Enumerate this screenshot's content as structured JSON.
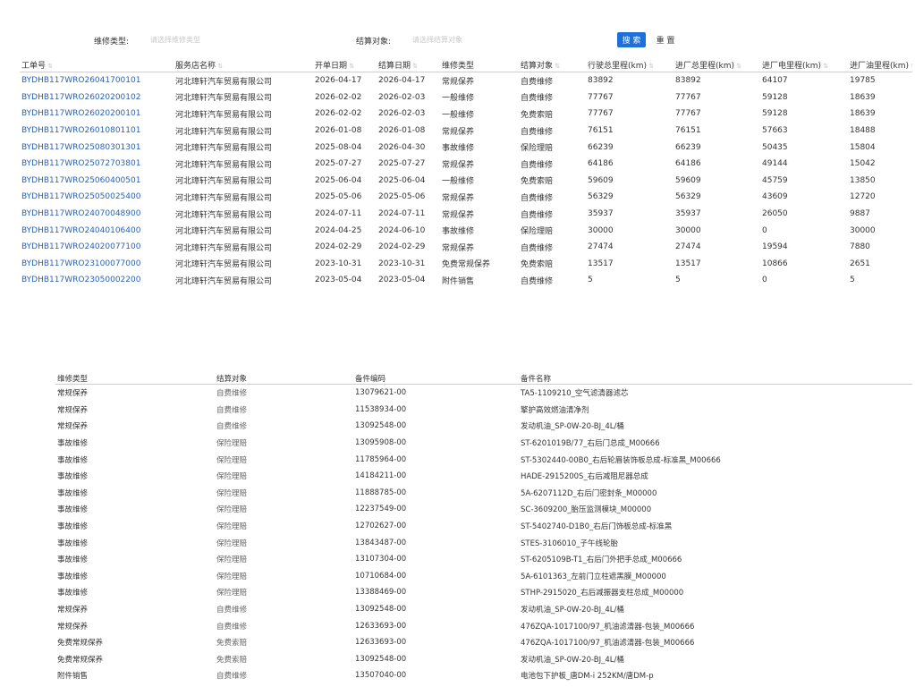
{
  "filters": {
    "repair_type_label": "维修类型:",
    "repair_type_placeholder": "请选择维修类型",
    "settlement_label": "结算对象:",
    "settlement_placeholder": "请选择结算对象",
    "search_button": "搜 索",
    "reset_button": "重 置",
    "accent_color": "#1e6fd9",
    "link_color": "#2b63b6"
  },
  "orders": {
    "columns": [
      "工单号",
      "服务店名称",
      "开单日期",
      "结算日期",
      "维修类型",
      "结算对象",
      "行驶总里程(km)",
      "进厂总里程(km)",
      "进厂电里程(km)",
      "进厂油里程(km)"
    ],
    "rows": [
      [
        "BYDHB117WRO26041700101",
        "河北璋轩汽车贸易有限公司",
        "2026-04-17",
        "2026-04-17",
        "常规保养",
        "自费维修",
        "83892",
        "83892",
        "64107",
        "19785"
      ],
      [
        "BYDHB117WRO26020200102",
        "河北璋轩汽车贸易有限公司",
        "2026-02-02",
        "2026-02-03",
        "一般维修",
        "自费维修",
        "77767",
        "77767",
        "59128",
        "18639"
      ],
      [
        "BYDHB117WRO26020200101",
        "河北璋轩汽车贸易有限公司",
        "2026-02-02",
        "2026-02-03",
        "一般维修",
        "免费索赔",
        "77767",
        "77767",
        "59128",
        "18639"
      ],
      [
        "BYDHB117WRO26010801101",
        "河北璋轩汽车贸易有限公司",
        "2026-01-08",
        "2026-01-08",
        "常规保养",
        "自费维修",
        "76151",
        "76151",
        "57663",
        "18488"
      ],
      [
        "BYDHB117WRO25080301301",
        "河北璋轩汽车贸易有限公司",
        "2025-08-04",
        "2026-04-30",
        "事故维修",
        "保险理赔",
        "66239",
        "66239",
        "50435",
        "15804"
      ],
      [
        "BYDHB117WRO25072703801",
        "河北璋轩汽车贸易有限公司",
        "2025-07-27",
        "2025-07-27",
        "常规保养",
        "自费维修",
        "64186",
        "64186",
        "49144",
        "15042"
      ],
      [
        "BYDHB117WRO25060400501",
        "河北璋轩汽车贸易有限公司",
        "2025-06-04",
        "2025-06-04",
        "一般维修",
        "免费索赔",
        "59609",
        "59609",
        "45759",
        "13850"
      ],
      [
        "BYDHB117WRO25050025400",
        "河北璋轩汽车贸易有限公司",
        "2025-05-06",
        "2025-05-06",
        "常规保养",
        "自费维修",
        "56329",
        "56329",
        "43609",
        "12720"
      ],
      [
        "BYDHB117WRO24070048900",
        "河北璋轩汽车贸易有限公司",
        "2024-07-11",
        "2024-07-11",
        "常规保养",
        "自费维修",
        "35937",
        "35937",
        "26050",
        "9887"
      ],
      [
        "BYDHB117WRO24040106400",
        "河北璋轩汽车贸易有限公司",
        "2024-04-25",
        "2024-06-10",
        "事故维修",
        "保险理赔",
        "30000",
        "30000",
        "0",
        "30000"
      ],
      [
        "BYDHB117WRO24020077100",
        "河北璋轩汽车贸易有限公司",
        "2024-02-29",
        "2024-02-29",
        "常规保养",
        "自费维修",
        "27474",
        "27474",
        "19594",
        "7880"
      ],
      [
        "BYDHB117WRO23100077000",
        "河北璋轩汽车贸易有限公司",
        "2023-10-31",
        "2023-10-31",
        "免费常规保养",
        "免费索赔",
        "13517",
        "13517",
        "10866",
        "2651"
      ],
      [
        "BYDHB117WRO23050002200",
        "河北璋轩汽车贸易有限公司",
        "2023-05-04",
        "2023-05-04",
        "附件销售",
        "自费维修",
        "5",
        "5",
        "0",
        "5"
      ]
    ]
  },
  "parts": {
    "columns": [
      "维修类型",
      "结算对象",
      "备件编码",
      "备件名称"
    ],
    "rows": [
      [
        "常规保养",
        "自费维修",
        "13079621-00",
        "TA5-1109210_空气滤清器滤芯"
      ],
      [
        "常规保养",
        "自费维修",
        "11538934-00",
        "擎护高效燃油清净剂"
      ],
      [
        "常规保养",
        "自费维修",
        "13092548-00",
        "发动机油_SP-0W-20-BJ_4L/桶"
      ],
      [
        "事故维修",
        "保险理赔",
        "13095908-00",
        "ST-6201019B/77_右后门总成_M00666"
      ],
      [
        "事故维修",
        "保险理赔",
        "11785964-00",
        "ST-5302440-00B0_右后轮眉装饰板总成-标准黑_M00666"
      ],
      [
        "事故维修",
        "保险理赔",
        "14184211-00",
        "HADE-2915200S_右后减阻尼器总成"
      ],
      [
        "事故维修",
        "保险理赔",
        "11888785-00",
        "5A-6207112D_右后门密封条_M00000"
      ],
      [
        "事故维修",
        "保险理赔",
        "12237549-00",
        "SC-3609200_胎压监测模块_M00000"
      ],
      [
        "事故维修",
        "保险理赔",
        "12702627-00",
        "ST-5402740-D1B0_右后门饰板总成-标准黑"
      ],
      [
        "事故维修",
        "保险理赔",
        "13843487-00",
        "STES-3106010_子午线轮胎"
      ],
      [
        "事故维修",
        "保险理赔",
        "13107304-00",
        "ST-6205109B-T1_右后门外把手总成_M00666"
      ],
      [
        "事故维修",
        "保险理赔",
        "10710684-00",
        "5A-6101363_左前门立柱遮黑膜_M00000"
      ],
      [
        "事故维修",
        "保险理赔",
        "13388469-00",
        "STHP-2915020_右后减振器支柱总成_M00000"
      ],
      [
        "常规保养",
        "自费维修",
        "13092548-00",
        "发动机油_SP-0W-20-BJ_4L/桶"
      ],
      [
        "常规保养",
        "自费维修",
        "12633693-00",
        "476ZQA-1017100/97_机油滤清器-包装_M00666"
      ],
      [
        "免费常规保养",
        "免费索赔",
        "12633693-00",
        "476ZQA-1017100/97_机油滤清器-包装_M00666"
      ],
      [
        "免费常规保养",
        "免费索赔",
        "13092548-00",
        "发动机油_SP-0W-20-BJ_4L/桶"
      ],
      [
        "附件销售",
        "自费维修",
        "13507040-00",
        "电池包下护板_唐DM-i 252KM/唐DM-p"
      ]
    ]
  }
}
